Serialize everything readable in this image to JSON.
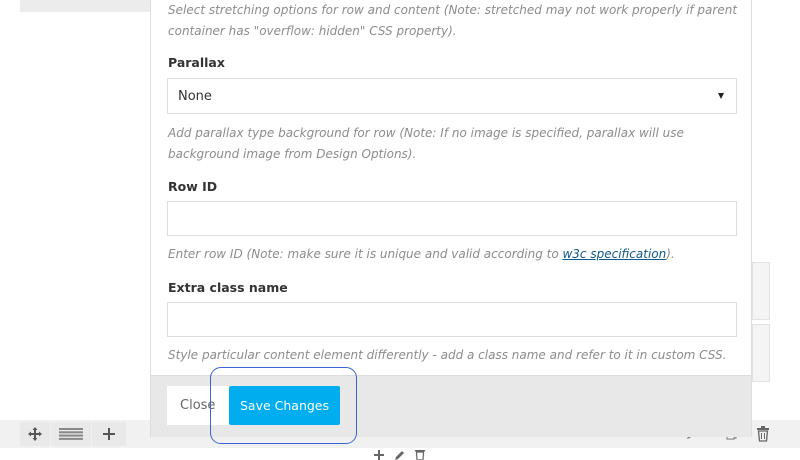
{
  "modal": {
    "stretch_help": "Select stretching options for row and content (Note: stretched may not work properly if parent container has \"overflow: hidden\" CSS property).",
    "parallax": {
      "label": "Parallax",
      "selected": "None",
      "help": "Add parallax type background for row (Note: If no image is specified, parallax will use background image from Design Options)."
    },
    "row_id": {
      "label": "Row ID",
      "value": "",
      "help_before": "Enter row ID (Note: make sure it is unique and valid according to ",
      "help_link": "w3c specification",
      "help_after": ")."
    },
    "extra_class": {
      "label": "Extra class name",
      "value": "",
      "help": "Style particular content element differently - add a class name and refer to it in custom CSS."
    },
    "footer": {
      "close_label": "Close",
      "save_label": "Save Changes"
    }
  },
  "row_toolbar": {
    "icons": [
      "move-icon",
      "column-layout-icon",
      "add-icon"
    ]
  },
  "right_toolbar": {
    "icons": [
      "edit-icon",
      "copy-icon",
      "delete-icon"
    ]
  },
  "bottom_toolbar": {
    "icons": [
      "add-icon",
      "edit-icon",
      "delete-icon"
    ]
  },
  "colors": {
    "accent": "#00aeef",
    "highlight": "#3a63d8",
    "link": "#0f5a8a"
  }
}
